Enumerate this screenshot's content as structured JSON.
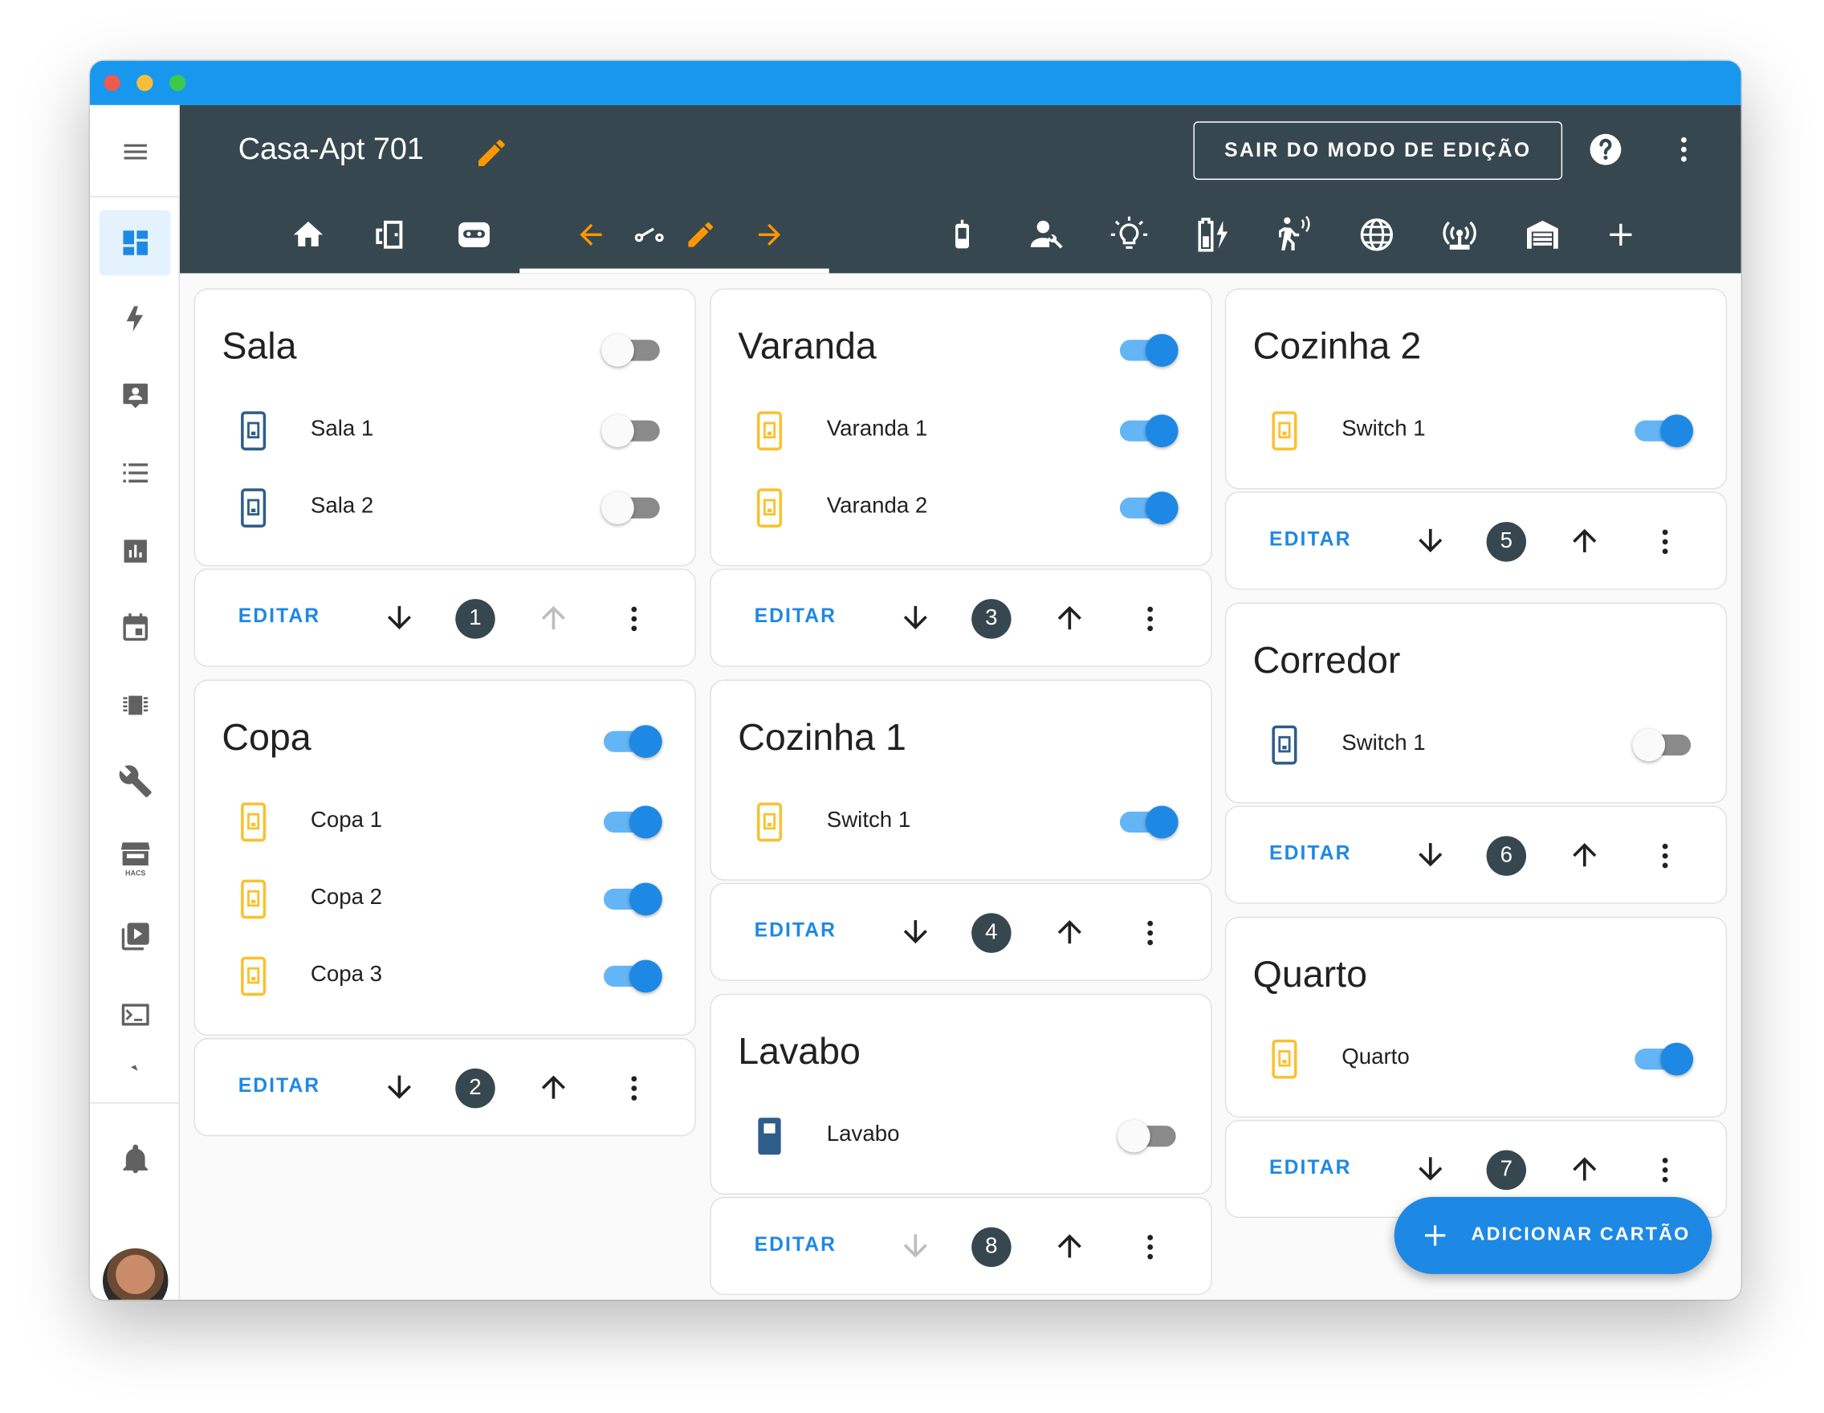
{
  "app": {
    "title": "Casa-Apt 701"
  },
  "header": {
    "exit_edit_label": "SAIR DO MODO DE EDIÇÃO",
    "tabs": [
      {
        "icon": "home-icon"
      },
      {
        "icon": "door-icon"
      },
      {
        "icon": "robot-vacuum-icon"
      },
      {
        "icon": "arrow-left-icon"
      },
      {
        "icon": "switch-icon"
      },
      {
        "icon": "pencil-icon"
      },
      {
        "icon": "arrow-right-icon"
      },
      {
        "icon": "cellphone-icon"
      },
      {
        "icon": "account-wrench-icon"
      },
      {
        "icon": "lightbulb-icon"
      },
      {
        "icon": "battery-charging-icon"
      },
      {
        "icon": "motion-sensor-icon"
      },
      {
        "icon": "globe-icon"
      },
      {
        "icon": "access-point-icon"
      },
      {
        "icon": "garage-icon"
      },
      {
        "icon": "plus-icon"
      }
    ]
  },
  "sidebar": {
    "items": [
      {
        "icon": "menu-icon"
      },
      {
        "icon": "dashboard-icon",
        "active": true
      },
      {
        "icon": "energy-icon"
      },
      {
        "icon": "account-box-icon"
      },
      {
        "icon": "list-icon"
      },
      {
        "icon": "chart-icon"
      },
      {
        "icon": "calendar-icon"
      },
      {
        "icon": "chip-icon"
      },
      {
        "icon": "wrench-icon"
      },
      {
        "icon": "hacs-store-icon",
        "label": "HACS"
      },
      {
        "icon": "media-icon"
      },
      {
        "icon": "terminal-icon"
      },
      {
        "icon": "bell-icon"
      },
      {
        "icon": "user-avatar"
      }
    ]
  },
  "colors": {
    "titlebar": "#1897ef",
    "header": "#37474f",
    "accent": "#1e88e5",
    "pencil": "#ff9800",
    "switch_on_icon": "#fbc02d",
    "switch_off_icon": "#2f5d8a"
  },
  "cards": [
    {
      "title": "Sala",
      "on": false,
      "position": 1,
      "entities": [
        {
          "label": "Sala 1",
          "on": false
        },
        {
          "label": "Sala 2",
          "on": false
        }
      ],
      "edit_label": "EDITAR",
      "up_enabled": false,
      "down_enabled": true
    },
    {
      "title": "Copa",
      "on": true,
      "position": 2,
      "entities": [
        {
          "label": "Copa 1",
          "on": true
        },
        {
          "label": "Copa 2",
          "on": true
        },
        {
          "label": "Copa 3",
          "on": true
        }
      ],
      "edit_label": "EDITAR",
      "up_enabled": true,
      "down_enabled": true
    },
    {
      "title": "Varanda",
      "on": true,
      "position": 3,
      "entities": [
        {
          "label": "Varanda 1",
          "on": true
        },
        {
          "label": "Varanda 2",
          "on": true
        }
      ],
      "edit_label": "EDITAR",
      "up_enabled": true,
      "down_enabled": true
    },
    {
      "title": "Cozinha 1",
      "position": 4,
      "entities": [
        {
          "label": "Switch 1",
          "on": true
        }
      ],
      "edit_label": "EDITAR",
      "up_enabled": true,
      "down_enabled": true
    },
    {
      "title": "Lavabo",
      "position": 8,
      "entities": [
        {
          "label": "Lavabo",
          "on": false
        }
      ],
      "edit_label": "EDITAR",
      "up_enabled": true,
      "down_enabled": false
    },
    {
      "title": "Cozinha 2",
      "position": 5,
      "entities": [
        {
          "label": "Switch 1",
          "on": true
        }
      ],
      "edit_label": "EDITAR",
      "up_enabled": true,
      "down_enabled": true
    },
    {
      "title": "Corredor",
      "position": 6,
      "entities": [
        {
          "label": "Switch 1",
          "on": false
        }
      ],
      "edit_label": "EDITAR",
      "up_enabled": true,
      "down_enabled": true
    },
    {
      "title": "Quarto",
      "position": 7,
      "entities": [
        {
          "label": "Quarto",
          "on": true
        }
      ],
      "edit_label": "EDITAR",
      "up_enabled": true,
      "down_enabled": true
    }
  ],
  "fab": {
    "label": "ADICIONAR CARTÃO"
  }
}
